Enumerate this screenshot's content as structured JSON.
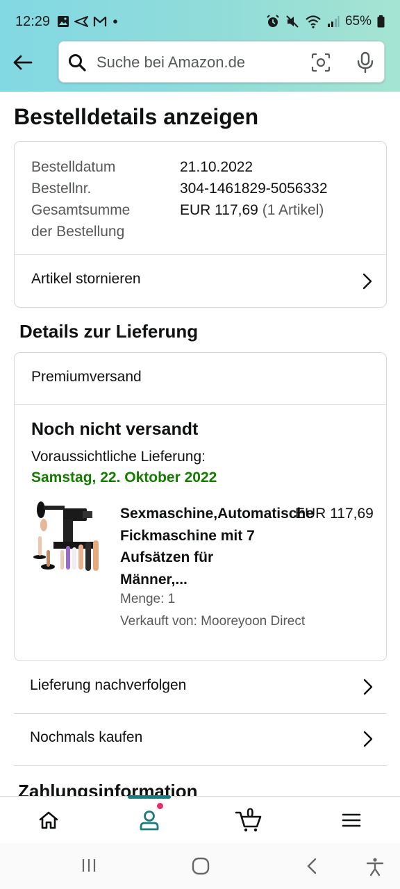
{
  "status_bar": {
    "time": "12:29",
    "battery": "65%"
  },
  "search": {
    "placeholder": "Suche bei Amazon.de"
  },
  "page": {
    "title": "Bestelldetails anzeigen"
  },
  "order_summary": {
    "date_label": "Bestelldatum",
    "date_value": "21.10.2022",
    "number_label": "Bestellnr.",
    "number_value": "304-1461829-5056332",
    "total_label_line1": "Gesamtsumme",
    "total_label_line2": "der Bestellung",
    "total_value": "EUR 117,69",
    "total_items": "(1 Artikel)",
    "cancel_label": "Artikel stornieren"
  },
  "delivery": {
    "section_title": "Details zur Lieferung",
    "shipping_type": "Premiumversand",
    "status": "Noch nicht versandt",
    "eta_label": "Voraussichtliche Lieferung:",
    "eta_date": "Samstag, 22. Oktober 2022",
    "product": {
      "title_line1": "Sexmaschine,Automatische",
      "title_line2": "Fickmaschine mit 7",
      "title_line3": "Aufsätzen für",
      "title_line4": "Männer,...",
      "price": "EUR 117,69",
      "quantity": "Menge: 1",
      "seller": "Verkauft von: Mooreyoon Direct"
    }
  },
  "actions": {
    "track": "Lieferung nachverfolgen",
    "buy_again": "Nochmals kaufen"
  },
  "payment": {
    "section_title": "Zahlungsinformation"
  },
  "bottom_nav": {
    "cart_count": "0"
  },
  "colors": {
    "header_gradient_start": "#82d8e3",
    "header_gradient_end": "#a5e4d2",
    "delivery_date_green": "#147c00",
    "nav_indicator": "#1e7a7f",
    "notification_dot": "#e22e6b"
  }
}
